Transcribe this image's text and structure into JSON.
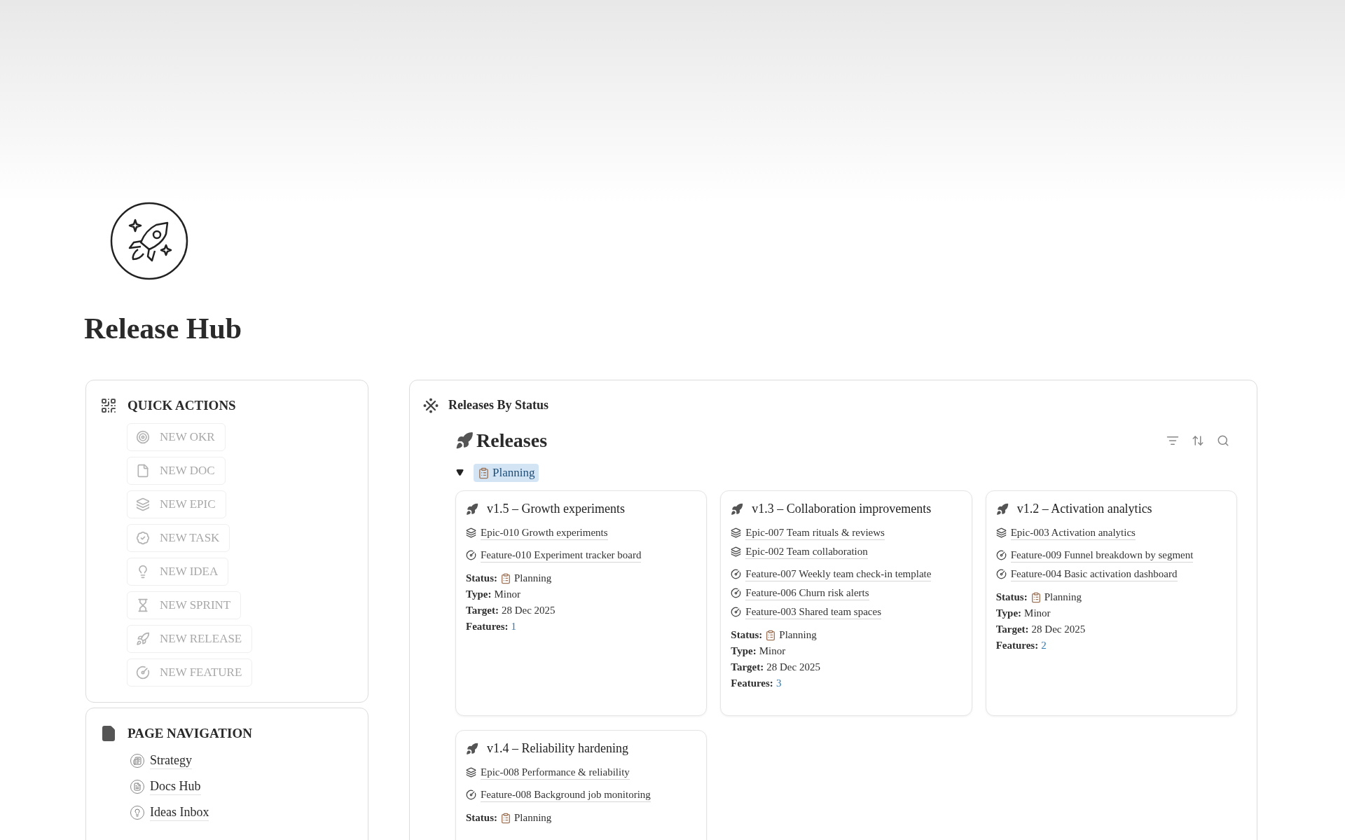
{
  "page": {
    "title": "Release Hub"
  },
  "quick_actions": {
    "title": "QUICK ACTIONS",
    "buttons": [
      {
        "label": "NEW OKR",
        "kind": "okr"
      },
      {
        "label": "NEW DOC",
        "kind": "doc"
      },
      {
        "label": "NEW EPIC",
        "kind": "epic"
      },
      {
        "label": "NEW TASK",
        "kind": "task"
      },
      {
        "label": "NEW IDEA",
        "kind": "idea"
      },
      {
        "label": "NEW SPRINT",
        "kind": "sprint"
      },
      {
        "label": "NEW RELEASE",
        "kind": "release"
      },
      {
        "label": "NEW FEATURE",
        "kind": "feature"
      }
    ]
  },
  "page_navigation": {
    "title": "PAGE NAVIGATION",
    "items": [
      {
        "label": "Strategy",
        "kind": "strategy"
      },
      {
        "label": "Docs Hub",
        "kind": "docs"
      },
      {
        "label": "Ideas Inbox",
        "kind": "ideas"
      }
    ]
  },
  "releases_panel": {
    "title": "Releases By Status",
    "view_title": "Releases",
    "groups": [
      {
        "label": "Planning",
        "expanded": true,
        "cards": [
          {
            "title": "v1.5 – Growth experiments",
            "links": [
              {
                "kind": "epic",
                "label": "Epic-010 Growth experiments"
              },
              {
                "kind": "feature",
                "label": "Feature-010 Experiment tracker board"
              }
            ],
            "fields": [
              {
                "kind": "status",
                "label": "Status:",
                "value": "Planning"
              },
              {
                "kind": "text",
                "label": "Type:",
                "value": "Minor"
              },
              {
                "kind": "text",
                "label": "Target:",
                "value": "28 Dec 2025"
              },
              {
                "kind": "count",
                "label": "Features:",
                "value": "1"
              }
            ]
          },
          {
            "title": "v1.3 – Collaboration improvements",
            "links": [
              {
                "kind": "epic",
                "label": "Epic-007 Team rituals & reviews"
              },
              {
                "kind": "epic",
                "label": "Epic-002 Team collaboration"
              },
              {
                "kind": "feature",
                "label": "Feature-007 Weekly team check-in template"
              },
              {
                "kind": "feature",
                "label": "Feature-006 Churn risk alerts"
              },
              {
                "kind": "feature",
                "label": "Feature-003 Shared team spaces"
              }
            ],
            "fields": [
              {
                "kind": "status",
                "label": "Status:",
                "value": "Planning"
              },
              {
                "kind": "text",
                "label": "Type:",
                "value": "Minor"
              },
              {
                "kind": "text",
                "label": "Target:",
                "value": "28 Dec 2025"
              },
              {
                "kind": "count",
                "label": "Features:",
                "value": "3"
              }
            ]
          },
          {
            "title": "v1.2 – Activation analytics",
            "links": [
              {
                "kind": "epic",
                "label": "Epic-003 Activation analytics"
              },
              {
                "kind": "feature",
                "label": "Feature-009 Funnel breakdown by segment"
              },
              {
                "kind": "feature",
                "label": "Feature-004 Basic activation dashboard"
              }
            ],
            "fields": [
              {
                "kind": "status",
                "label": "Status:",
                "value": "Planning"
              },
              {
                "kind": "text",
                "label": "Type:",
                "value": "Minor"
              },
              {
                "kind": "text",
                "label": "Target:",
                "value": "28 Dec 2025"
              },
              {
                "kind": "count",
                "label": "Features:",
                "value": "2"
              }
            ]
          },
          {
            "title": "v1.4 – Reliability hardening",
            "links": [
              {
                "kind": "epic",
                "label": "Epic-008 Performance & reliability"
              },
              {
                "kind": "feature",
                "label": "Feature-008 Background job monitoring"
              }
            ],
            "fields": [
              {
                "kind": "status",
                "label": "Status:",
                "value": "Planning"
              }
            ]
          }
        ]
      }
    ]
  }
}
